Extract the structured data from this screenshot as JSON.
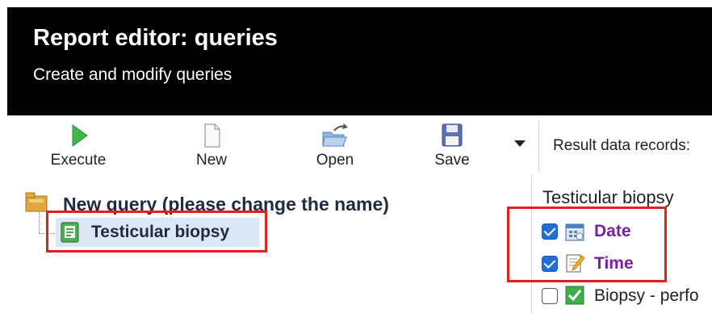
{
  "header": {
    "title": "Report editor: queries",
    "subtitle": "Create and modify queries"
  },
  "toolbar": {
    "execute_label": "Execute",
    "new_label": "New",
    "open_label": "Open",
    "save_label": "Save",
    "result_records_label": "Result data records:"
  },
  "tree": {
    "query_name": "New query (please change the name)",
    "node_label": "Testicular biopsy"
  },
  "fields_panel": {
    "title": "Testicular biopsy",
    "items": [
      {
        "label": "Date",
        "checked": true,
        "icon": "calendar-icon"
      },
      {
        "label": "Time",
        "checked": true,
        "icon": "edit-note-icon"
      },
      {
        "label": "Biopsy - perfo",
        "checked": false,
        "icon": "green-check-icon"
      }
    ]
  },
  "colors": {
    "header_bg": "#000000",
    "highlight_box": "#e12020",
    "field_label": "#7b1fa2",
    "checkbox": "#1f6fd6",
    "selected_node_bg": "#dde6f7"
  }
}
